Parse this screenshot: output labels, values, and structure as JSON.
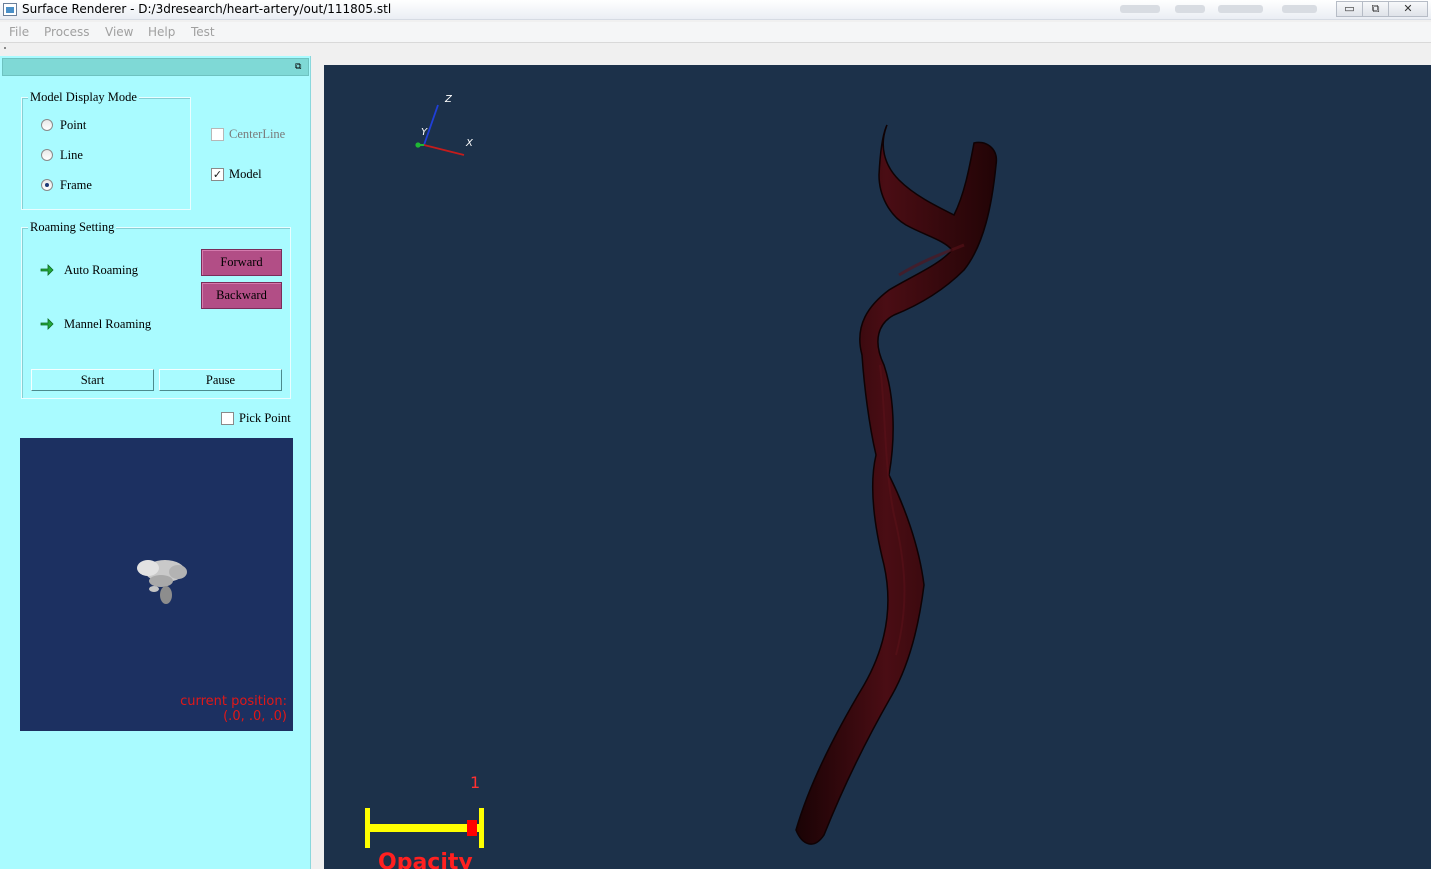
{
  "window": {
    "title": "Surface Renderer - D:/3dresearch/heart-artery/out/111805.stl",
    "controls": {
      "minimize": "▭",
      "maximize": "⧉",
      "close": "✕"
    }
  },
  "menu": [
    "File",
    "Process",
    "View",
    "Help",
    "Test"
  ],
  "dock": {
    "float_icon": "⧉",
    "display_mode": {
      "title": "Model Display Mode",
      "options": [
        "Point",
        "Line",
        "Frame"
      ],
      "selected": "Frame"
    },
    "checks": {
      "centerline": {
        "label": "CenterLine",
        "checked": false,
        "enabled": false
      },
      "model": {
        "label": "Model",
        "checked": true,
        "enabled": true
      }
    },
    "roaming": {
      "title": "Roaming Setting",
      "auto_label": "Auto Roaming",
      "manual_label": "Mannel Roaming",
      "forward": "Forward",
      "backward": "Backward",
      "start": "Start",
      "pause": "Pause"
    },
    "pick_point": {
      "label": "Pick Point",
      "checked": false
    },
    "minimap": {
      "position_label": "current position:",
      "position_value": "(.0, .0, .0)"
    }
  },
  "viewport": {
    "axes": {
      "z": "Z",
      "y": "Y",
      "x": "X"
    },
    "opacity_slider": {
      "title": "Opacity",
      "value": "1",
      "level": 1.0
    },
    "colors": {
      "background": "#1c314a",
      "artery": "#3a0a10",
      "slider_bar": "#ffff00",
      "slider_handle": "#ff0000"
    }
  }
}
